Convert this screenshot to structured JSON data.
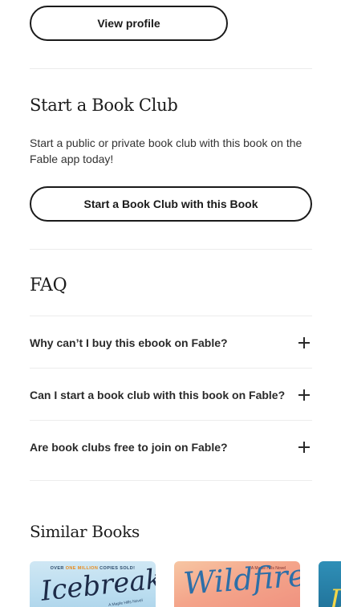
{
  "profile": {
    "button_label": "View profile"
  },
  "book_club": {
    "heading": "Start a Book Club",
    "description": "Start a public or private book club with this book on the Fable app today!",
    "button_label": "Start a Book Club with this Book"
  },
  "faq": {
    "heading": "FAQ",
    "items": [
      {
        "question": "Why can’t I buy this ebook on Fable?",
        "icon": "plus-icon"
      },
      {
        "question": "Can I start a book club with this book on Fable?",
        "icon": "plus-icon"
      },
      {
        "question": "Are book clubs free to join on Fable?",
        "icon": "plus-icon"
      }
    ]
  },
  "similar": {
    "heading": "Similar Books",
    "books": [
      {
        "title": "Icebreaker",
        "tag_pre": "OVER",
        "tag_highlight": "ONE MILLION",
        "tag_post": "COPIES SOLD!",
        "subtitle": "A Maple Hills Novel",
        "accent": "#1d2b48"
      },
      {
        "title": "Wildfire",
        "tag": "A Maple Hills Novel",
        "accent": "#2d6fa8"
      },
      {
        "title": "D",
        "accent": "#f2d64a"
      }
    ]
  }
}
